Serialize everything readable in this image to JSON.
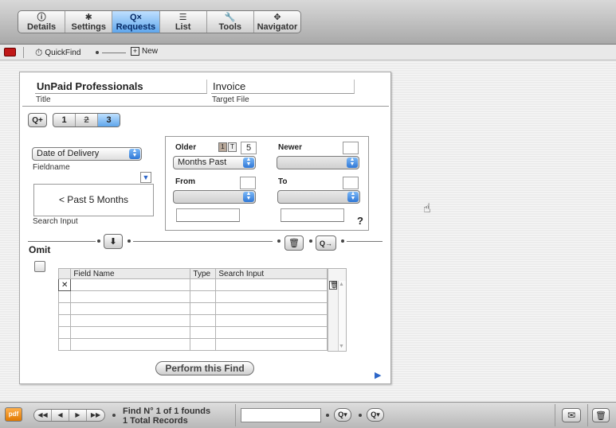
{
  "toolbar": {
    "tabs": [
      {
        "label": "Details",
        "icon": "ⓘ"
      },
      {
        "label": "Settings",
        "icon": "✱"
      },
      {
        "label": "Requests",
        "icon": "Q×"
      },
      {
        "label": "List",
        "icon": "☰"
      },
      {
        "label": "Tools",
        "icon": "🔧"
      },
      {
        "label": "Navigator",
        "icon": "✥"
      }
    ],
    "active_tab": "Requests"
  },
  "subbar": {
    "quickfind_label": "QuickFind",
    "new_label": "New"
  },
  "panel": {
    "title_value": "UnPaid Professionals",
    "title_label": "Title",
    "target_value": "Invoice",
    "target_label": "Target File",
    "steps": [
      "1",
      "2",
      "3"
    ],
    "fieldname_value": "Date of Delivery",
    "fieldname_label": "Fieldname",
    "search_input_value": "< Past 5 Months",
    "search_input_label": "Search Input",
    "older_label": "Older",
    "older_mode_1": "1",
    "older_mode_t": "T",
    "older_value": "5",
    "older_popup": "Months Past",
    "newer_label": "Newer",
    "from_label": "From",
    "to_label": "To",
    "help": "?",
    "omit_label": "Omit",
    "table": {
      "headers": [
        "Field Name",
        "Type",
        "Search Input"
      ],
      "row_marker": "✕"
    },
    "perform_button": "Perform this Find"
  },
  "bottom": {
    "find_status": "Find N° 1 of 1 founds",
    "total_records": "1 Total Records",
    "pdf_label": "pdf"
  }
}
